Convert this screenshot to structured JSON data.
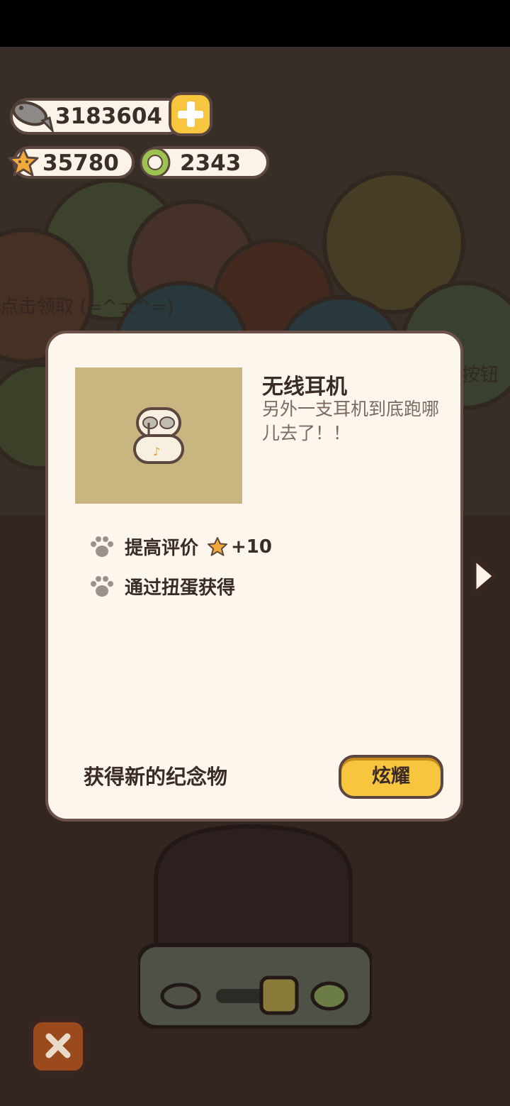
{
  "currency": {
    "fish": "3183604",
    "stars": "35780",
    "coins": "2343"
  },
  "background_hints": {
    "left": "点击领取 (=^ェ^=)",
    "right": "按钮"
  },
  "modal": {
    "item_title": "无线耳机",
    "item_description": "另外一支耳机到底跑哪儿去了！！",
    "attributes": [
      {
        "label": "提高评价",
        "star_bonus": "+10"
      },
      {
        "label": "通过扭蛋获得"
      }
    ],
    "footer_label": "获得新的纪念物",
    "share_button": "炫耀"
  },
  "colors": {
    "accent_yellow": "#f7c63e",
    "panel": "#fcf6ec",
    "border": "#6b514a",
    "thumb_bg": "#c8b57f"
  },
  "icons": [
    "fish-icon",
    "plus-icon",
    "star-icon",
    "coin-icon",
    "paw-icon",
    "earphone-case-icon",
    "close-icon",
    "arrow-right-icon"
  ]
}
